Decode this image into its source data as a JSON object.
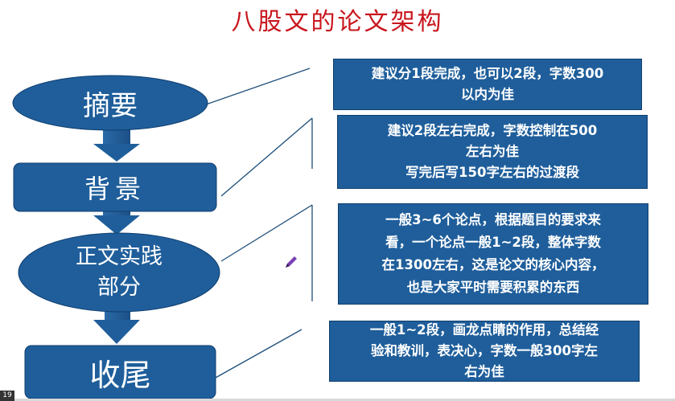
{
  "title": "八股文的论文架构",
  "nodes": [
    {
      "label": "摘要"
    },
    {
      "label": "背景"
    },
    {
      "label_line1": "正文实践",
      "label_line2": "部分"
    },
    {
      "label": "收尾"
    }
  ],
  "notes": [
    {
      "lines": [
        "建议分1段完成，也可以2段，字数300",
        "以内为佳"
      ]
    },
    {
      "lines": [
        "建议2段左右完成，字数控制在500",
        "左右为佳",
        "写完后写150字左右的过渡段"
      ]
    },
    {
      "lines": [
        "一般3~6个论点，根据题目的要求来",
        "看，一个论点一般1~2段，整体字数",
        "在1300左右，这是论文的核心内容，",
        "也是大家平时需要积累的东西"
      ]
    },
    {
      "lines": [
        "一般1~2段，画龙点睛的作用，总结经",
        "验和教训，表决心，字数一般300字左",
        "右为佳"
      ]
    }
  ],
  "page_number": "19",
  "colors": {
    "title": "#c8161d",
    "shape_fill": "#1f5e9b",
    "connector": "#1f4e79"
  }
}
